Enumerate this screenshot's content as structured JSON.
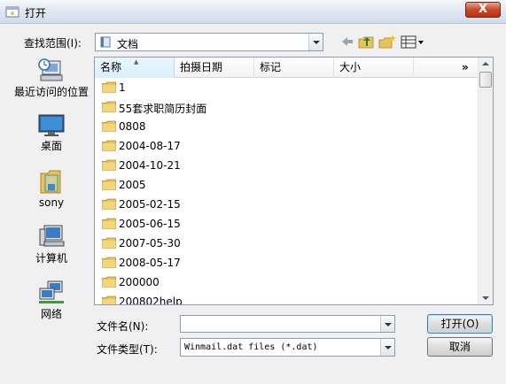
{
  "window": {
    "title": "打开",
    "close_label": "X",
    "icon": "open-dialog-icon"
  },
  "lookin": {
    "label": "查找范围(I):",
    "value": "文档",
    "toolbar": [
      "back-arrow-icon",
      "up-one-level-icon",
      "create-new-folder-icon",
      "views-menu-icon"
    ]
  },
  "places": [
    {
      "label": "最近访问的位置",
      "icon": "recent-places-icon"
    },
    {
      "label": "桌面",
      "icon": "desktop-icon"
    },
    {
      "label": "sony",
      "icon": "user-folder-icon"
    },
    {
      "label": "计算机",
      "icon": "computer-icon"
    },
    {
      "label": "网络",
      "icon": "network-icon"
    }
  ],
  "list": {
    "columns": {
      "name": "名称",
      "date": "拍摄日期",
      "tags": "标记",
      "size": "大小",
      "more": "»"
    },
    "rows": [
      "1",
      "55套求职简历封面",
      "0808",
      "2004-08-17",
      "2004-10-21",
      "2005",
      "2005-02-15",
      "2005-06-15",
      "2007-05-30",
      "2008-05-17",
      "200000",
      "200802help"
    ]
  },
  "filename": {
    "label": "文件名(N):",
    "value": ""
  },
  "filetype": {
    "label": "文件类型(T):",
    "value": "Winmail.dat files (*.dat)"
  },
  "buttons": {
    "open": "打开(O)",
    "cancel": "取消"
  },
  "colors": {
    "folder": "#e8c25a",
    "selection_header": "#d9f0fc",
    "close": "#c7482a"
  }
}
